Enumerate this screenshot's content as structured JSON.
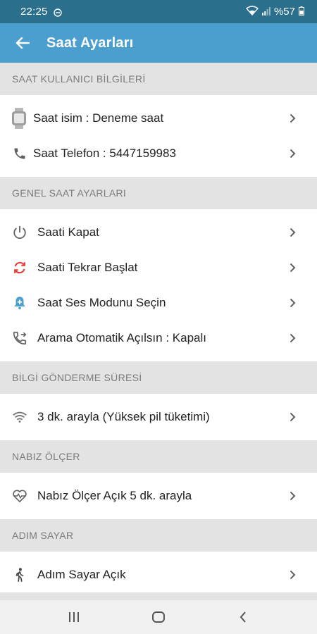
{
  "status_bar": {
    "time": "22:25",
    "battery": "%57"
  },
  "app_bar": {
    "title": "Saat Ayarları"
  },
  "sections": [
    {
      "header": "SAAT KULLANICI BİLGİLERİ",
      "items": [
        {
          "icon": "watch-icon",
          "label": "Saat isim : Deneme saat"
        },
        {
          "icon": "phone-icon",
          "label": "Saat Telefon : 5447159983"
        }
      ]
    },
    {
      "header": "GENEL SAAT AYARLARI",
      "items": [
        {
          "icon": "power-icon",
          "label": "Saati Kapat"
        },
        {
          "icon": "restart-icon",
          "label": "Saati Tekrar Başlat"
        },
        {
          "icon": "bell-add-icon",
          "label": "Saat Ses Modunu Seçin"
        },
        {
          "icon": "phone-forward-icon",
          "label": "Arama Otomatik Açılsın : Kapalı"
        }
      ]
    },
    {
      "header": "BİLGİ GÖNDERME SÜRESİ",
      "items": [
        {
          "icon": "wifi-icon",
          "label": "3 dk. arayla (Yüksek pil tüketimi)"
        }
      ]
    },
    {
      "header": "NABIZ ÖLÇER",
      "items": [
        {
          "icon": "heart-pulse-icon",
          "label": "Nabız Ölçer Açık 5 dk. arayla"
        }
      ]
    },
    {
      "header": "ADIM SAYAR",
      "items": [
        {
          "icon": "walk-icon",
          "label": "Adım Sayar Açık"
        }
      ]
    }
  ],
  "colors": {
    "status_bar": "#2a6f8c",
    "app_bar": "#4a9fcf",
    "restart_icon": "#e53935",
    "bell_icon": "#4a9fcf",
    "section_bg": "#e3e3e3"
  }
}
